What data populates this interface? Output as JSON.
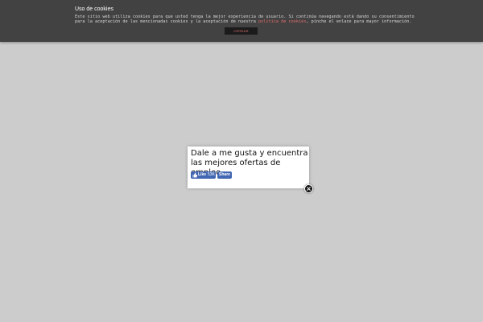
{
  "cookie_bar": {
    "title": "Uso de cookies",
    "text_before_link": "Este sitio web utiliza cookies para que usted tenga la mejor experiencia de usuario. Si continúa navegando está dando su consentimiento para la aceptación de las mencionadas cookies y la aceptación de nuestra ",
    "link_text": "política de cookies",
    "text_after_link": ", pinche el enlace para mayor información.",
    "close_label": "CERRAR",
    "background_color": "#424242",
    "link_color": "#e06a6a"
  },
  "modal": {
    "heading": "Dale a me gusta y encuentra las mejores ofertas de empleo",
    "like_label": "Like",
    "like_count": "53K",
    "share_label": "Share",
    "like_icon": "thumbs-up-icon",
    "close_icon": "close-icon",
    "facebook_color": "#4267b2"
  },
  "page": {
    "overlay_color": "#cccccc"
  }
}
